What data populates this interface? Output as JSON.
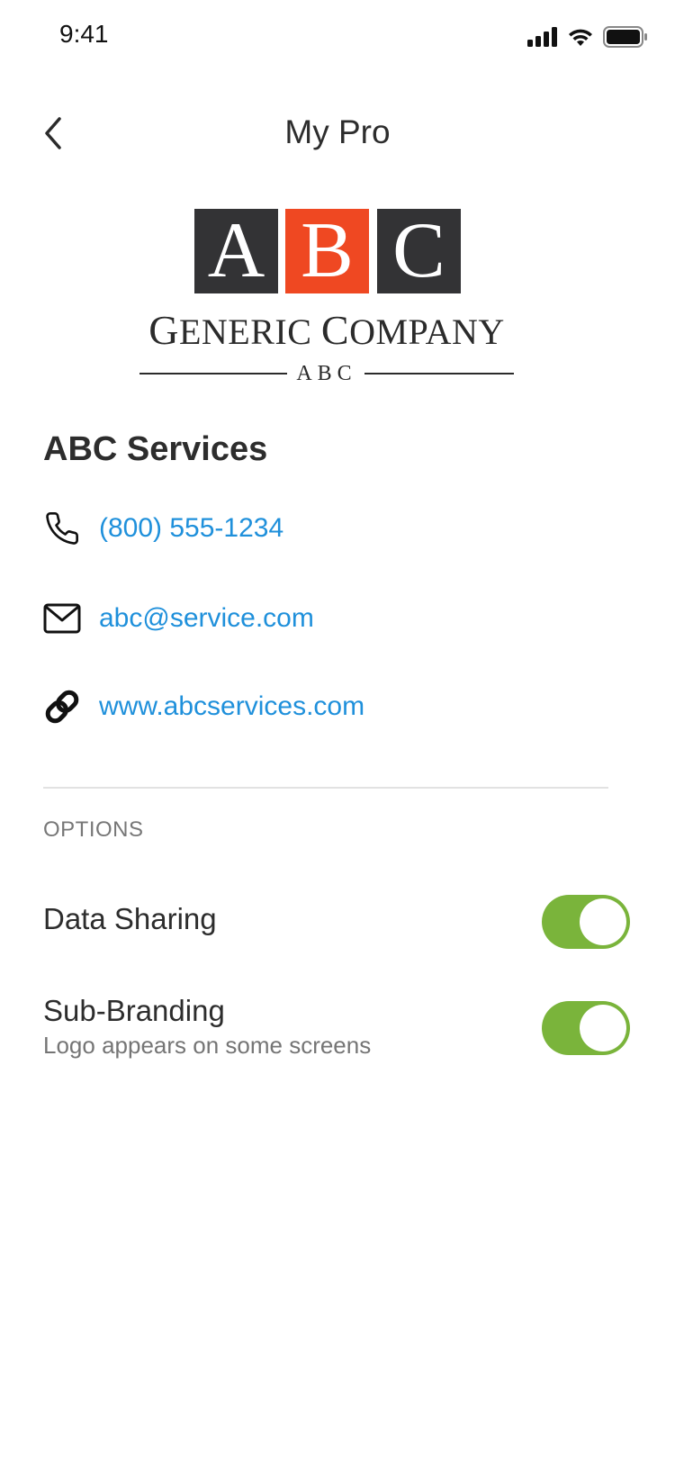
{
  "status_bar": {
    "time": "9:41"
  },
  "header": {
    "title": "My Pro",
    "back_icon": "chevron-left-icon"
  },
  "logo": {
    "letters": [
      "A",
      "B",
      "C"
    ],
    "company_first_big": "G",
    "company_first_rest": "ENERIC",
    "company_second_big": "C",
    "company_second_rest": "OMPANY",
    "tag": "ABC",
    "colors": {
      "dark": "#333335",
      "accent": "#ef4822"
    }
  },
  "company": {
    "name": "ABC Services",
    "phone": "(800) 555-1234",
    "email": "abc@service.com",
    "website": "www.abcservices.com",
    "link_color": "#1f90db",
    "icons": {
      "phone": "phone-icon",
      "email": "mail-icon",
      "website": "link-icon"
    }
  },
  "options": {
    "section_label": "OPTIONS",
    "items": [
      {
        "label": "Data Sharing",
        "enabled": true
      },
      {
        "label": "Sub-Branding",
        "subtitle": "Logo appears on some screens",
        "enabled": true
      }
    ],
    "toggle_on_color": "#7ab43b"
  }
}
